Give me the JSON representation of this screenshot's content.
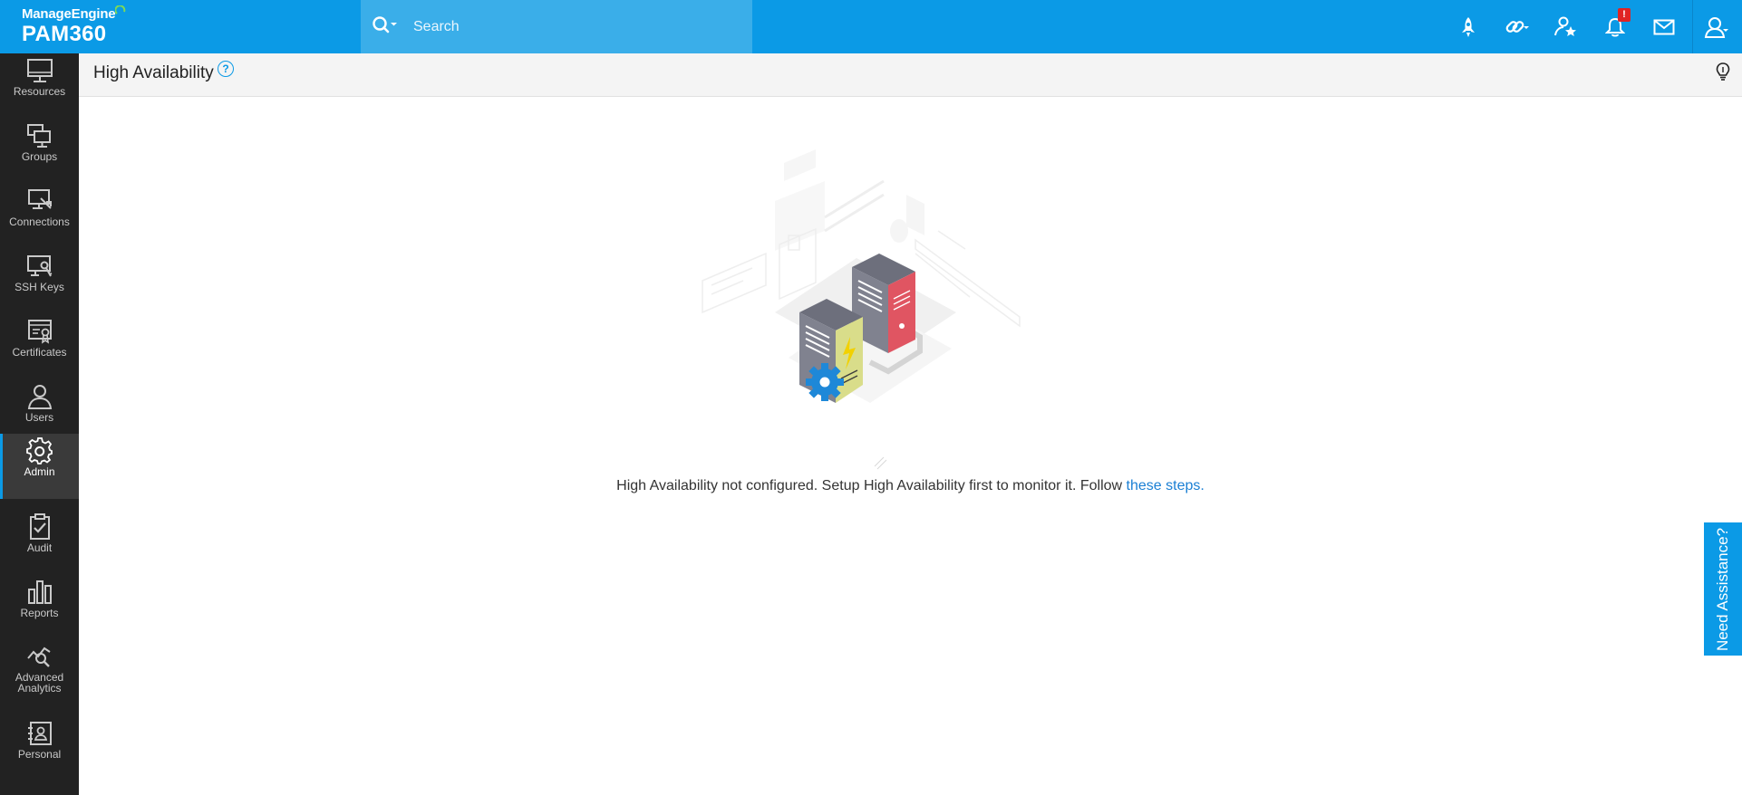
{
  "brand": {
    "company": "ManageEngine",
    "product": "PAM360"
  },
  "search": {
    "placeholder": "Search"
  },
  "topbar_icons": [
    "rocket-icon",
    "link-icon",
    "star-user-icon",
    "bell-icon",
    "mail-icon",
    "user-icon"
  ],
  "notifications": {
    "badge": "!"
  },
  "sidebar": {
    "items": [
      {
        "label": "Resources",
        "icon": "monitor-icon",
        "active": false
      },
      {
        "label": "Groups",
        "icon": "groups-icon",
        "active": false
      },
      {
        "label": "Connections",
        "icon": "connections-icon",
        "active": false
      },
      {
        "label": "SSH Keys",
        "icon": "ssh-key-icon",
        "active": false
      },
      {
        "label": "Certificates",
        "icon": "certificate-icon",
        "active": false
      },
      {
        "label": "Users",
        "icon": "users-icon",
        "active": false
      },
      {
        "label": "Admin",
        "icon": "gear-icon",
        "active": true
      },
      {
        "label": "Audit",
        "icon": "clipboard-check-icon",
        "active": false
      },
      {
        "label": "Reports",
        "icon": "bar-chart-icon",
        "active": false
      },
      {
        "label": "Advanced Analytics",
        "label_line1": "Advanced",
        "label_line2": "Analytics",
        "icon": "analytics-icon",
        "active": false
      },
      {
        "label": "Personal",
        "icon": "personal-icon",
        "active": false
      }
    ]
  },
  "page": {
    "title": "High Availability",
    "help": "?"
  },
  "message": {
    "text": "High Availability not configured. Setup High Availability first to monitor it. Follow ",
    "link": "these steps",
    "suffix": "."
  },
  "assist": {
    "label": "Need Assistance?"
  },
  "colors": {
    "topbar": "#0b9ae6",
    "search_bg": "#3aaee9",
    "sidebar": "#222222",
    "active_indicator": "#0b9ae6",
    "link": "#1a7fd4",
    "badge": "#e02424"
  }
}
